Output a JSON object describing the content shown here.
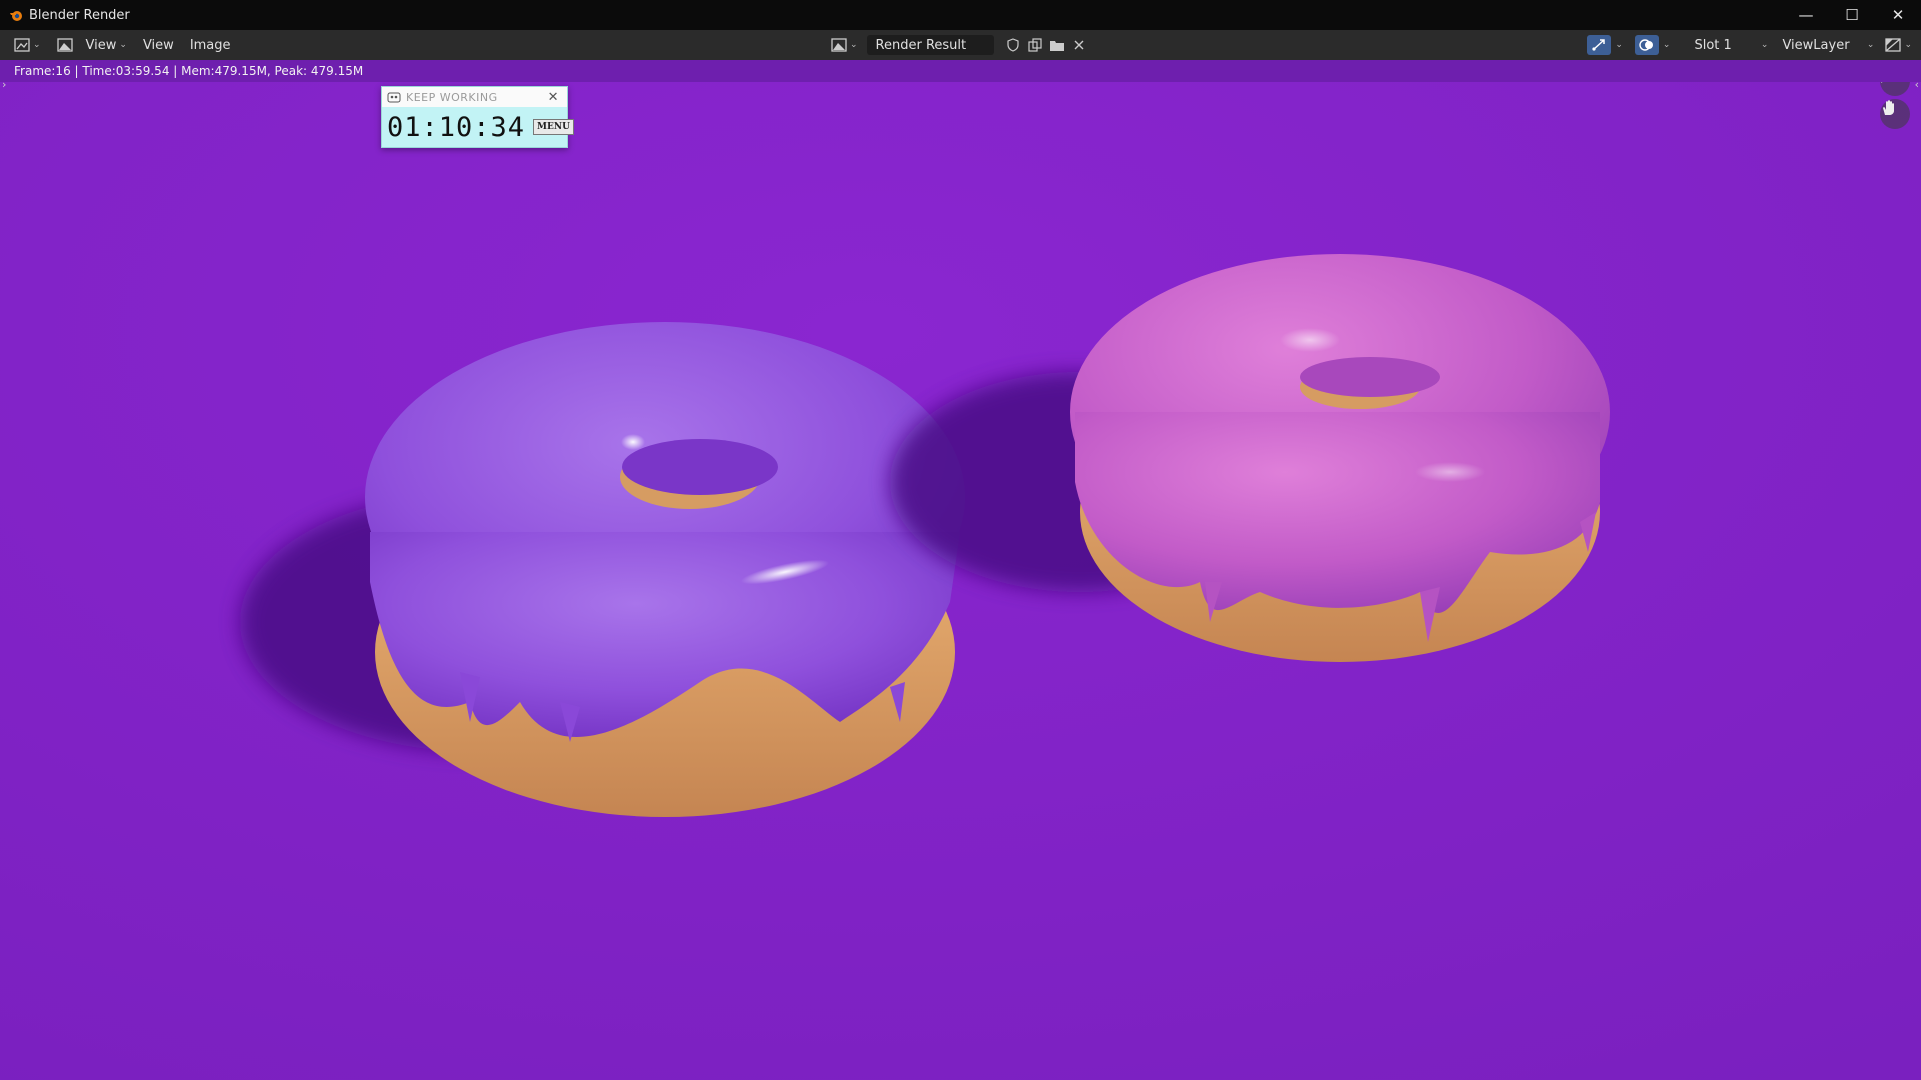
{
  "window": {
    "title": "Blender Render",
    "controls": {
      "minimize": "—",
      "maximize": "☐",
      "close": "✕"
    }
  },
  "header": {
    "menus": [
      "View",
      "View",
      "Image"
    ],
    "image_name": "Render Result",
    "slot": "Slot 1",
    "view_layer": "ViewLayer"
  },
  "status": {
    "text": "Frame:16 | Time:03:59.54 | Mem:479.15M, Peak: 479.15M"
  },
  "timer_widget": {
    "title": "KEEP WORKING",
    "time": "01:10:34",
    "menu_label": "MENU",
    "close": "✕"
  },
  "colors": {
    "background": "#7f22c6",
    "donut_left_glaze": "#8f4fd8",
    "donut_right_glaze": "#c15bc7",
    "dough": "#e3a66a",
    "accent_button": "#3d5f96"
  },
  "icons": {
    "editor_type": "image-editor-icon",
    "view_mode": "image-icon",
    "browse_image": "image-browse-icon",
    "fake_user": "shield-icon",
    "duplicate": "duplicate-icon",
    "open": "folder-icon",
    "unlink": "close-icon",
    "gizmo": "gizmo-icon",
    "overlay": "overlay-icon",
    "display_channels": "channels-icon",
    "zoom": "zoom-icon",
    "pan": "hand-icon"
  }
}
